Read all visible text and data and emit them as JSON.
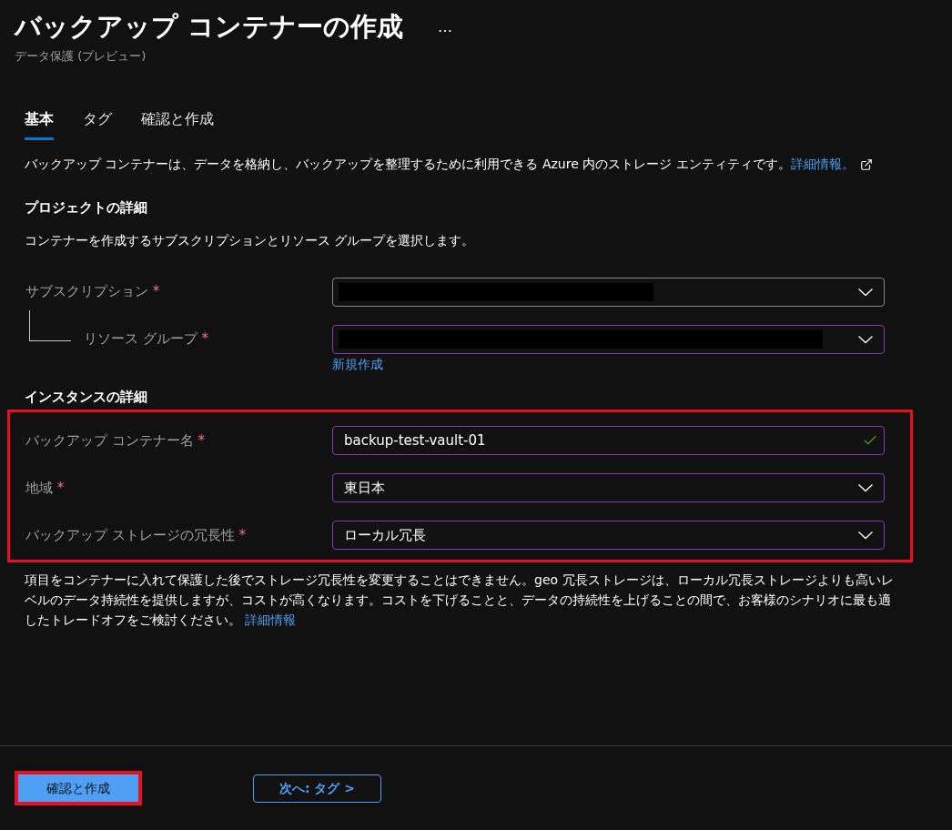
{
  "header": {
    "title": "バックアップ コンテナーの作成",
    "more": "…",
    "subtitle": "データ保護 (プレビュー)"
  },
  "tabs": [
    {
      "label": "基本",
      "selected": true
    },
    {
      "label": "タグ",
      "selected": false
    },
    {
      "label": "確認と作成",
      "selected": false
    }
  ],
  "intro": {
    "text": "バックアップ コンテナーは、データを格納し、バックアップを整理するために利用できる Azure 内のストレージ エンティティです。",
    "link": "詳細情報。"
  },
  "project": {
    "heading": "プロジェクトの詳細",
    "description": "コンテナーを作成するサブスクリプションとリソース グループを選択します。",
    "fields": [
      {
        "label": "サブスクリプション",
        "required": "*",
        "kind": "dropdown",
        "child": false,
        "redacted": true,
        "focused": false
      },
      {
        "label": "リソース グループ",
        "required": "*",
        "kind": "dropdown",
        "child": true,
        "redacted": true,
        "focused": true,
        "link": "新規作成"
      }
    ]
  },
  "instance": {
    "heading": "インスタンスの詳細",
    "annotated": true,
    "fields": [
      {
        "label": "バックアップ コンテナー名",
        "required": "*",
        "kind": "text",
        "value": "backup-test-vault-01",
        "valid": true,
        "focused": true
      },
      {
        "label": "地域",
        "required": "*",
        "kind": "dropdown",
        "value": "東日本",
        "focused": true
      },
      {
        "label": "バックアップ ストレージの冗長性",
        "required": "*",
        "kind": "dropdown",
        "value": "ローカル冗長",
        "focused": true
      }
    ]
  },
  "note": {
    "text": "項目をコンテナーに入れて保護した後でストレージ冗長性を変更することはできません。geo 冗長ストレージは、ローカル冗長ストレージよりも高いレベルのデータ持続性を提供しますが、コストが高くなります。コストを下げることと、データの持続性を上げることの間で、お客様のシナリオに最も適したトレードオフをご検討ください。",
    "link": "詳細情報"
  },
  "footer": {
    "primary": {
      "label": "確認と作成",
      "annotated": true
    },
    "next": {
      "label": "次へ: タグ >"
    }
  }
}
